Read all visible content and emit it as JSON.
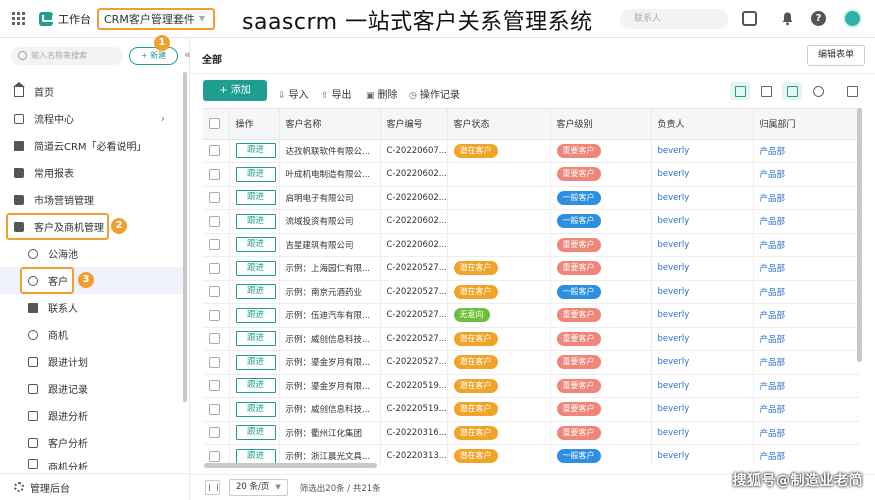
{
  "topbar": {
    "app_name": "工作台",
    "suite_tab": "CRM客户管理套件",
    "headline": "saascrm 一站式客户关系管理系统",
    "search_placeholder": "联系人",
    "help_glyph": "?"
  },
  "sidebar": {
    "search_placeholder": "输入名称来搜索",
    "new_button": "+ 新建",
    "collapse_glyph": "«",
    "badges": [
      "1",
      "2",
      "3"
    ],
    "items": [
      {
        "label": "首页",
        "icon": "home-icon"
      },
      {
        "label": "流程中心",
        "icon": "flow-icon",
        "arrow": "›"
      },
      {
        "label": "简道云CRM「必看说明」",
        "icon": "document-icon"
      },
      {
        "label": "常用报表",
        "icon": "folder-icon"
      },
      {
        "label": "市场营销管理",
        "icon": "folder-icon"
      },
      {
        "label": "客户及商机管理",
        "icon": "folder-open-icon"
      },
      {
        "label": "公海池",
        "icon": "users-icon"
      },
      {
        "label": "客户",
        "icon": "user-icon"
      },
      {
        "label": "联系人",
        "icon": "contact-icon"
      },
      {
        "label": "商机",
        "icon": "opportunity-icon"
      },
      {
        "label": "跟进计划",
        "icon": "plan-icon"
      },
      {
        "label": "跟进记录",
        "icon": "record-icon"
      },
      {
        "label": "跟进分析",
        "icon": "chart-icon"
      },
      {
        "label": "客户分析",
        "icon": "chart-icon"
      },
      {
        "label": "商机分析",
        "icon": "chart-icon"
      }
    ],
    "admin": "管理后台"
  },
  "main": {
    "all_label": "全部",
    "edit_form": "编辑表单",
    "toolbar": {
      "add": "+ 添加",
      "import": "导入",
      "export": "导出",
      "delete": "删除",
      "history": "操作记录"
    },
    "columns": [
      "操作",
      "客户名称",
      "客户编号",
      "客户状态",
      "客户级别",
      "负责人",
      "归属部门"
    ],
    "follow_label": "跟进",
    "rows": [
      {
        "name": "达孜帆联软件有限公...",
        "code": "C-20220607...",
        "status": "潜在客户",
        "status_color": "orange",
        "level": "重要客户",
        "level_color": "red",
        "owner": "beverly",
        "dept": "产品部"
      },
      {
        "name": "叶成机电制造有限公...",
        "code": "C-20220602...",
        "status": "",
        "status_color": "",
        "level": "重要客户",
        "level_color": "red",
        "owner": "beverly",
        "dept": "产品部"
      },
      {
        "name": "启明电子有限公司",
        "code": "C-20220602...",
        "status": "",
        "status_color": "",
        "level": "一般客户",
        "level_color": "blue",
        "owner": "beverly",
        "dept": "产品部"
      },
      {
        "name": "流域投资有限公司",
        "code": "C-20220602...",
        "status": "",
        "status_color": "",
        "level": "一般客户",
        "level_color": "blue",
        "owner": "beverly",
        "dept": "产品部"
      },
      {
        "name": "吉星建筑有限公司",
        "code": "C-20220602...",
        "status": "",
        "status_color": "",
        "level": "重要客户",
        "level_color": "red",
        "owner": "beverly",
        "dept": "产品部"
      },
      {
        "name": "示例：上海园仁有限...",
        "code": "C-20220527...",
        "status": "潜在客户",
        "status_color": "orange",
        "level": "重要客户",
        "level_color": "red",
        "owner": "beverly",
        "dept": "产品部"
      },
      {
        "name": "示例：南京元酒药业",
        "code": "C-20220527...",
        "status": "潜在客户",
        "status_color": "orange",
        "level": "一般客户",
        "level_color": "blue",
        "owner": "beverly",
        "dept": "产品部"
      },
      {
        "name": "示例：伍迪汽车有限...",
        "code": "C-20220527...",
        "status": "无意向",
        "status_color": "green",
        "level": "重要客户",
        "level_color": "red",
        "owner": "beverly",
        "dept": "产品部"
      },
      {
        "name": "示例：威创信息科技...",
        "code": "C-20220527...",
        "status": "潜在客户",
        "status_color": "orange",
        "level": "重要客户",
        "level_color": "red",
        "owner": "beverly",
        "dept": "产品部"
      },
      {
        "name": "示例：鎏金岁月有限...",
        "code": "C-20220527...",
        "status": "潜在客户",
        "status_color": "orange",
        "level": "重要客户",
        "level_color": "red",
        "owner": "beverly",
        "dept": "产品部"
      },
      {
        "name": "示例：鎏金岁月有限...",
        "code": "C-20220519...",
        "status": "潜在客户",
        "status_color": "orange",
        "level": "重要客户",
        "level_color": "red",
        "owner": "beverly",
        "dept": "产品部"
      },
      {
        "name": "示例：威创信息科技...",
        "code": "C-20220519...",
        "status": "潜在客户",
        "status_color": "orange",
        "level": "重要客户",
        "level_color": "red",
        "owner": "beverly",
        "dept": "产品部"
      },
      {
        "name": "示例：衢州江化集团",
        "code": "C-20220316...",
        "status": "潜在客户",
        "status_color": "orange",
        "level": "重要客户",
        "level_color": "red",
        "owner": "beverly",
        "dept": "产品部"
      },
      {
        "name": "示例：浙江晨光文具...",
        "code": "C-20220313...",
        "status": "潜在客户",
        "status_color": "orange",
        "level": "一般客户",
        "level_color": "blue",
        "owner": "beverly",
        "dept": "产品部"
      }
    ]
  },
  "footer": {
    "page_size": "20 条/页",
    "summary": "筛选出20条 / 共21条"
  },
  "watermark": "搜狐号@制造业老简",
  "colors": {
    "accent": "#1f9e8f",
    "highlight": "#f0a030",
    "tag_orange": "#f0a52a",
    "tag_red": "#f08679",
    "tag_blue": "#2d8fe0",
    "tag_green": "#6fbf3a",
    "link": "#2d6fd0"
  }
}
